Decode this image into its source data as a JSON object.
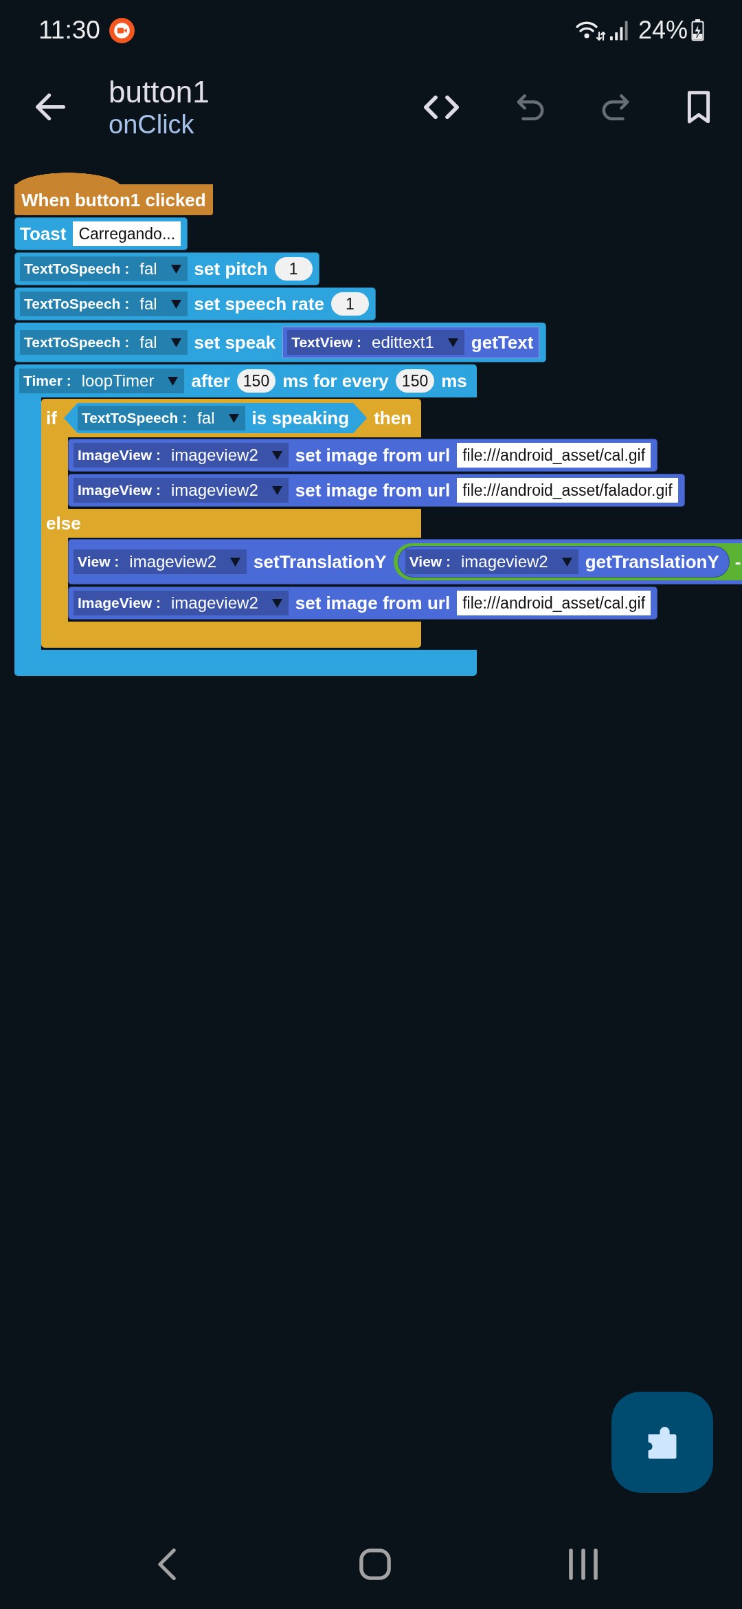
{
  "status_bar": {
    "time": "11:30",
    "battery": "24%"
  },
  "app_bar": {
    "title": "button1",
    "subtitle": "onClick",
    "actions": [
      {
        "kind": "code",
        "disabled": false
      },
      {
        "kind": "undo",
        "disabled": true
      },
      {
        "kind": "redo",
        "disabled": true
      },
      {
        "kind": "bookmark",
        "disabled": false
      }
    ]
  },
  "workspace": {
    "event": {
      "label": "When button1 clicked",
      "color": "#c9842f",
      "body": [
        {
          "kind": "statement",
          "color": "#2ea4df",
          "parts": [
            {
              "kind": "label",
              "text": "Toast"
            },
            {
              "kind": "text",
              "value": "Carregando..."
            }
          ]
        },
        {
          "kind": "statement",
          "color": "#2ea4df",
          "parts": [
            {
              "kind": "dropdown",
              "component": "TextToSpeech :",
              "value": "fal"
            },
            {
              "kind": "label",
              "text": "set pitch"
            },
            {
              "kind": "number",
              "value": "1"
            }
          ]
        },
        {
          "kind": "statement",
          "color": "#2ea4df",
          "parts": [
            {
              "kind": "dropdown",
              "component": "TextToSpeech :",
              "value": "fal"
            },
            {
              "kind": "label",
              "text": "set speech rate"
            },
            {
              "kind": "number",
              "value": "1"
            }
          ]
        },
        {
          "kind": "statement",
          "color": "#2ea4df",
          "parts": [
            {
              "kind": "dropdown",
              "component": "TextToSpeech :",
              "value": "fal"
            },
            {
              "kind": "label",
              "text": "set speak"
            },
            {
              "kind": "reporter",
              "color": "#4a6ad7",
              "parts": [
                {
                  "kind": "dropdown",
                  "component": "TextView :",
                  "value": "edittext1"
                },
                {
                  "kind": "label",
                  "text": "getText"
                }
              ]
            }
          ]
        },
        {
          "kind": "c_block",
          "color": "#2ea4df",
          "sections": [
            {
              "parts": [
                {
                  "kind": "dropdown",
                  "component": "Timer :",
                  "value": "loopTimer"
                },
                {
                  "kind": "label",
                  "text": "after"
                },
                {
                  "kind": "number",
                  "value": "150"
                },
                {
                  "kind": "label",
                  "text": "ms for every"
                },
                {
                  "kind": "number",
                  "value": "150"
                },
                {
                  "kind": "label",
                  "text": "ms"
                }
              ],
              "body": [
                {
                  "kind": "c_block",
                  "color": "#dea92b",
                  "sections": [
                    {
                      "parts": [
                        {
                          "kind": "label",
                          "text": "if"
                        },
                        {
                          "kind": "boolean",
                          "color": "#2ea4df",
                          "parts": [
                            {
                              "kind": "dropdown",
                              "component": "TextToSpeech :",
                              "value": "fal"
                            },
                            {
                              "kind": "label",
                              "text": "is speaking"
                            }
                          ]
                        },
                        {
                          "kind": "label",
                          "text": "then"
                        }
                      ],
                      "body": [
                        {
                          "kind": "statement",
                          "color": "#4a6ad7",
                          "parts": [
                            {
                              "kind": "dropdown",
                              "component": "ImageView :",
                              "value": "imageview2"
                            },
                            {
                              "kind": "label",
                              "text": "set image from url"
                            },
                            {
                              "kind": "text",
                              "value": "file:///android_asset/cal.gif"
                            }
                          ]
                        },
                        {
                          "kind": "statement",
                          "color": "#4a6ad7",
                          "parts": [
                            {
                              "kind": "dropdown",
                              "component": "ImageView :",
                              "value": "imageview2"
                            },
                            {
                              "kind": "label",
                              "text": "set image from url"
                            },
                            {
                              "kind": "text",
                              "value": "file:///android_asset/falador.gif"
                            }
                          ]
                        }
                      ]
                    },
                    {
                      "parts": [
                        {
                          "kind": "label",
                          "text": "else"
                        }
                      ],
                      "body": [
                        {
                          "kind": "statement",
                          "color": "#4a6ad7",
                          "parts": [
                            {
                              "kind": "dropdown",
                              "component": "View :",
                              "value": "imageview2"
                            },
                            {
                              "kind": "label",
                              "text": "setTranslationY"
                            },
                            {
                              "kind": "operator",
                              "color": "#5cb232",
                              "parts": [
                                {
                                  "kind": "round_reporter",
                                  "color": "#4a6ad7",
                                  "parts": [
                                    {
                                      "kind": "dropdown",
                                      "component": "View :",
                                      "value": "imageview2"
                                    },
                                    {
                                      "kind": "label",
                                      "text": "getTranslationY"
                                    }
                                  ]
                                },
                                {
                                  "kind": "label",
                                  "text": "-"
                                }
                              ]
                            }
                          ]
                        },
                        {
                          "kind": "statement",
                          "color": "#4a6ad7",
                          "parts": [
                            {
                              "kind": "dropdown",
                              "component": "ImageView :",
                              "value": "imageview2"
                            },
                            {
                              "kind": "label",
                              "text": "set image from url"
                            },
                            {
                              "kind": "text",
                              "value": "file:///android_asset/cal.gif"
                            }
                          ]
                        }
                      ]
                    }
                  ]
                }
              ]
            }
          ]
        }
      ]
    }
  }
}
